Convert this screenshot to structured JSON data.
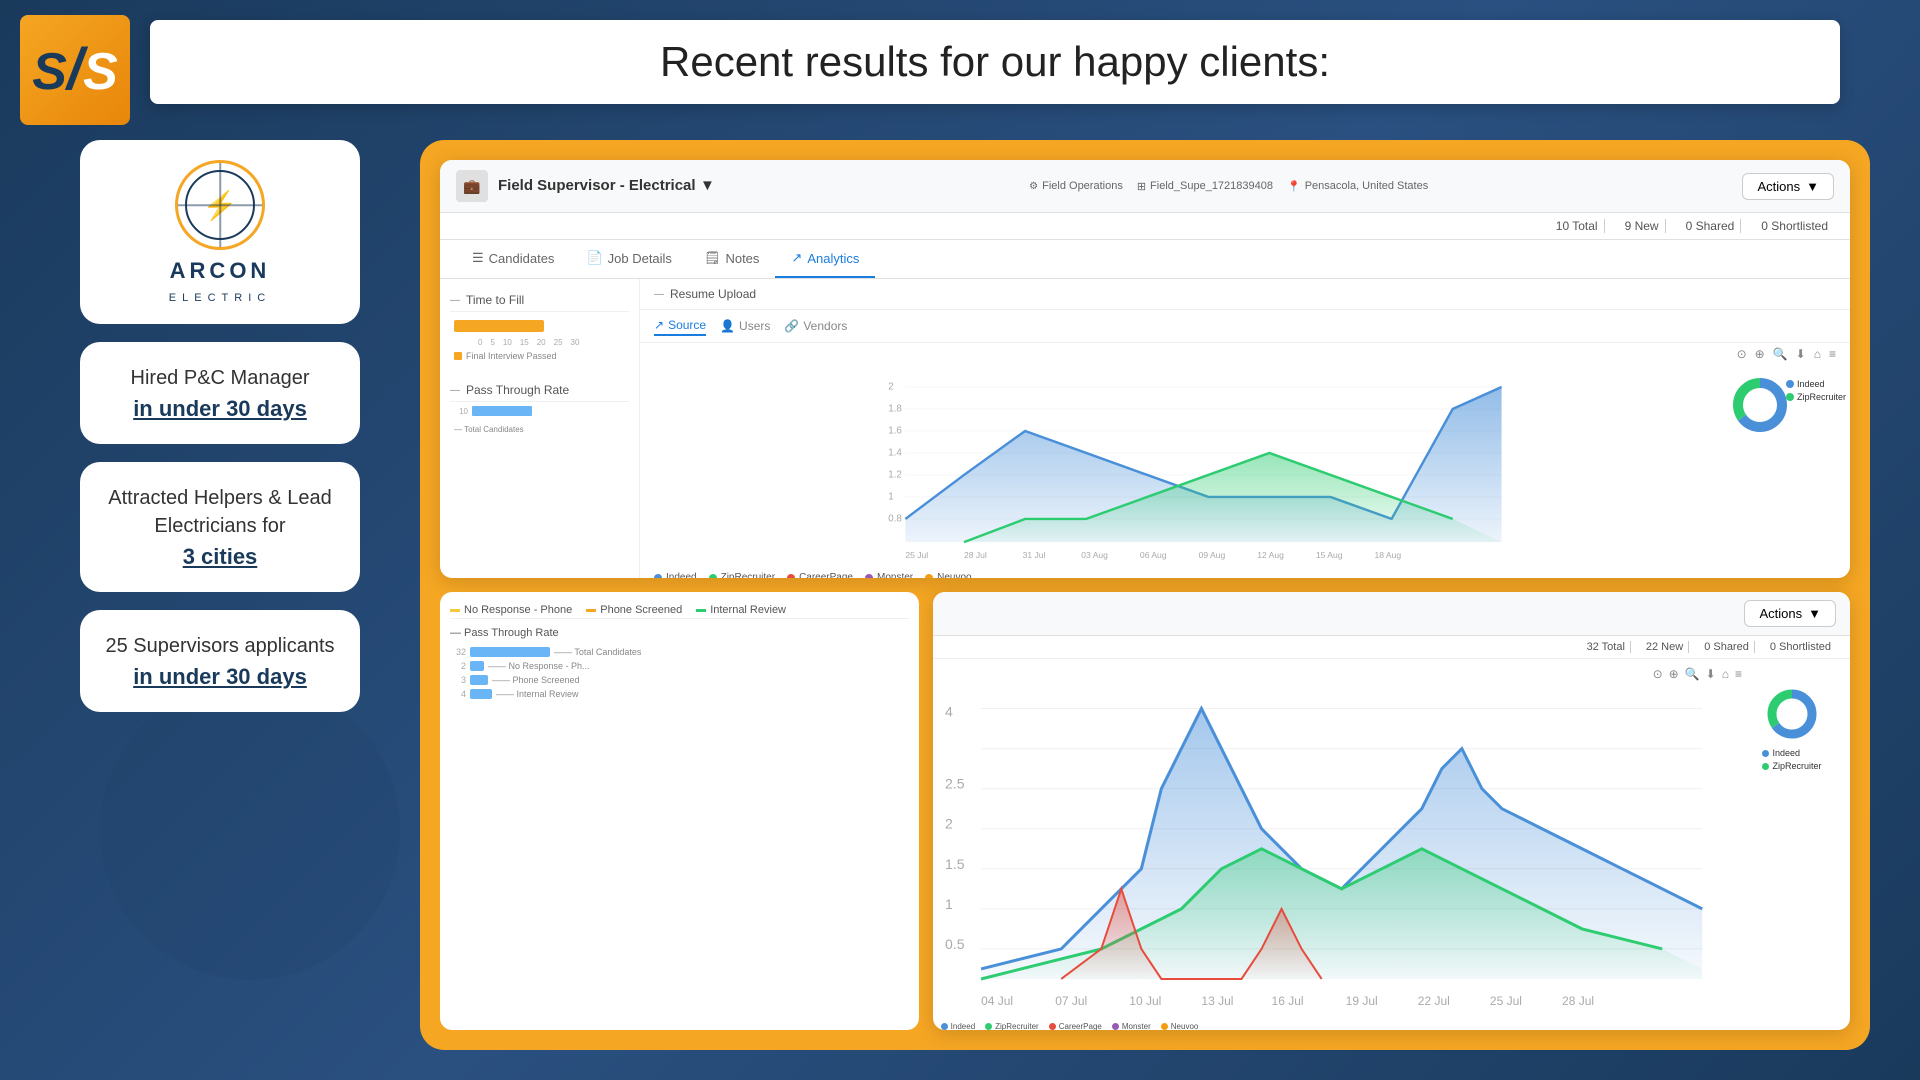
{
  "page": {
    "title": "Recent results for our happy clients:",
    "background_color": "#1a3a5c"
  },
  "logo": {
    "letters": "SLS",
    "company": "ARCON",
    "subtitle": "ELECTRIC"
  },
  "header": {
    "title": "Recent results for our happy clients:"
  },
  "left_cards": [
    {
      "main": "Hired P&C Manager",
      "highlighted": "in under 30 days"
    },
    {
      "main": "Attracted Helpers &\nLead Electricians for",
      "highlighted": "3 cities"
    },
    {
      "main": "25 Supervisors\napplicants",
      "highlighted": "in under 30 days"
    }
  ],
  "ats_main": {
    "icon": "📋",
    "title": "Field Supervisor - Electrical",
    "dropdown": "▼",
    "meta": {
      "operations": "Field Operations",
      "id": "Field_Supe_1721839408",
      "location": "Pensacola, United States"
    },
    "actions_label": "Actions",
    "stats": {
      "total": "10 Total",
      "new": "9 New",
      "shared": "0 Shared",
      "shortlisted": "0 Shortlisted"
    },
    "tabs": [
      "Candidates",
      "Job Details",
      "Notes",
      "Analytics"
    ],
    "active_tab": "Analytics"
  },
  "analytics": {
    "time_to_fill_label": "Time to Fill",
    "pass_through_rate_label": "Pass Through Rate",
    "resume_upload_label": "Resume Upload",
    "source_tabs": [
      "Source",
      "Users",
      "Vendors"
    ],
    "active_source_tab": "Source",
    "chart_legend": [
      "Indeed",
      "ZipRecruiter",
      "CareerPage",
      "Monster",
      "Neuvoo"
    ],
    "legend_colors": [
      "#4a90d9",
      "#2ecc71",
      "#e74c3c",
      "#9b59b6",
      "#f39c12"
    ],
    "donut_legend": [
      "Indeed",
      "ZipRecruiter"
    ],
    "donut_colors": [
      "#4a90d9",
      "#2ecc71"
    ],
    "x_axis_labels": [
      "25 Jul",
      "28 Jul",
      "31 Jul",
      "03 Aug",
      "06 Aug",
      "09 Aug",
      "12 Aug",
      "15 Aug",
      "18 Aug"
    ],
    "pass_through_legend": [
      "No Response - Phone",
      "Phone Screened",
      "Internal Review"
    ],
    "pass_legend_colors": [
      "#f5c842",
      "#f5a623",
      "#2ecc71"
    ]
  },
  "ats_second": {
    "actions_label": "Actions",
    "stats": {
      "total": "32 Total",
      "new": "22 New",
      "shared": "0 Shared",
      "shortlisted": "0 Shortlisted"
    },
    "chart_x_labels": [
      "04 Jul",
      "07 Jul",
      "10 Jul",
      "13 Jul",
      "16 Jul",
      "19 Jul",
      "22 Jul",
      "25 Jul",
      "28 Jul"
    ],
    "legend": [
      "Indeed",
      "ZipRecruiter",
      "CareerPage",
      "Monster",
      "Neuvoo"
    ],
    "legend_colors": [
      "#4a90d9",
      "#2ecc71",
      "#e74c3c",
      "#9b59b6",
      "#f39c12"
    ],
    "donut_legend": [
      "Indeed",
      "ZipRecruiter"
    ],
    "pass_labels": [
      "Total Candidates",
      "No Response - P...",
      "Phone Screened",
      "Internal Review"
    ],
    "pass_values": [
      32,
      2,
      3,
      4
    ]
  }
}
